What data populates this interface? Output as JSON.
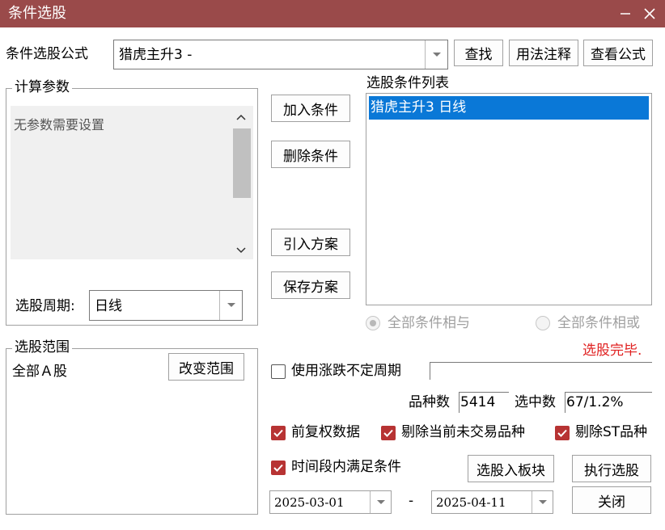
{
  "window": {
    "title": "条件选股",
    "minimize_icon": "minimize-icon",
    "close_icon": "close-icon"
  },
  "formula": {
    "label": "条件选股公式",
    "value": "猎虎主升3  -",
    "find_button": "查找",
    "usage_button": "用法注释",
    "view_button": "查看公式"
  },
  "params": {
    "legend": "计算参数",
    "text": "无参数需要设置"
  },
  "period": {
    "label": "选股周期:",
    "value": "日线"
  },
  "actions": {
    "add": "加入条件",
    "delete": "删除条件",
    "import": "引入方案",
    "save": "保存方案"
  },
  "conditions": {
    "title": "选股条件列表",
    "items": [
      "猎虎主升3  日线"
    ]
  },
  "logic": {
    "and_label": "全部条件相与",
    "or_label": "全部条件相或",
    "selected": "and"
  },
  "status": {
    "text": "选股完毕.",
    "color": "#e02020"
  },
  "range": {
    "legend": "选股范围",
    "value": "全部Ａ股",
    "change_button": "改变范围"
  },
  "variable_period": {
    "label": "使用涨跌不定周期",
    "checked": false
  },
  "stats": {
    "count_label": "品种数",
    "count_value": "5414",
    "selected_label": "选中数",
    "selected_value": "67/1.2%"
  },
  "options": {
    "adjusted": {
      "label": "前复权数据",
      "checked": true
    },
    "exclude_untraded": {
      "label": "剔除当前未交易品种",
      "checked": true
    },
    "exclude_st": {
      "label": "剔除ST品种",
      "checked": true
    },
    "time_range": {
      "label": "时间段内满足条件",
      "checked": true
    }
  },
  "dates": {
    "start": "2025-03-01",
    "separator": "-",
    "end": "2025-04-11"
  },
  "buttons": {
    "to_block": "选股入板块",
    "execute": "执行选股",
    "close": "关闭"
  },
  "colors": {
    "titlebar": "#9a4a4a",
    "selection": "#0a78d7",
    "checkbox": "#b73333"
  }
}
